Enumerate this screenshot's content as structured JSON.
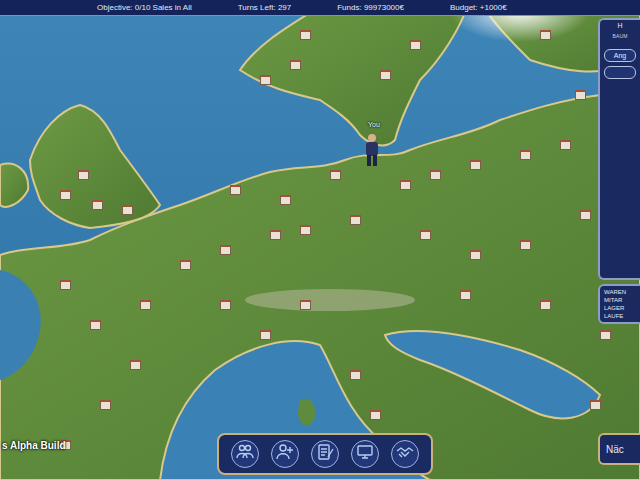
{
  "top_bar": {
    "objective": "Objective:  0/10 Sales in All",
    "turns": "Turns Left: 297",
    "funds": "Funds: 99973000€",
    "budget": "Budget: +1000€"
  },
  "map": {
    "player_label": "You"
  },
  "side_panel": {
    "title": "H",
    "subtitle": "BAUM",
    "buttons": [
      "Ang"
    ]
  },
  "info_panel": {
    "lines": [
      "WAREN",
      "MITAR",
      "LAGER",
      "LAUFE"
    ]
  },
  "next_button": "Näc",
  "build_label": "s Alpha Build"
}
